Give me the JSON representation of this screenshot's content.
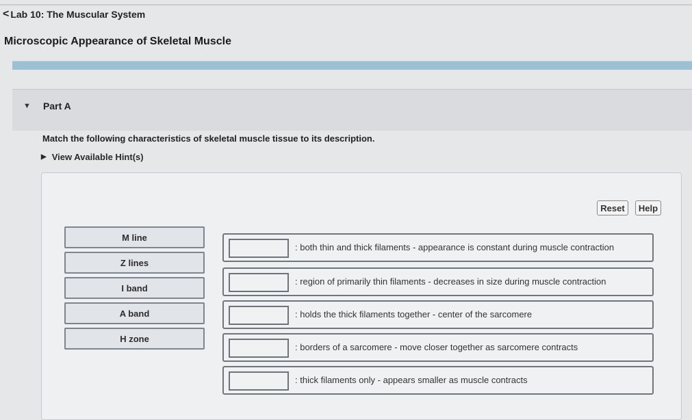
{
  "header": {
    "back_chevron": "<",
    "back_label": "Lab 10: The Muscular System",
    "title": "Microscopic Appearance of Skeletal Muscle"
  },
  "part": {
    "label": "Part A",
    "question": "Match the following characteristics of skeletal muscle tissue to its description.",
    "hints_label": "View Available Hint(s)"
  },
  "controls": {
    "reset_label": "Reset",
    "help_label": "Help"
  },
  "chips": [
    "M line",
    "Z lines",
    "I band",
    "A band",
    "H zone"
  ],
  "targets": [
    ": both thin and thick filaments - appearance is constant during muscle contraction",
    ": region of primarily thin filaments - decreases in size during muscle contraction",
    ": holds the thick filaments together - center of the sarcomere",
    ": borders of a sarcomere - move closer together as sarcomere contracts",
    ": thick filaments only - appears smaller as muscle contracts"
  ]
}
